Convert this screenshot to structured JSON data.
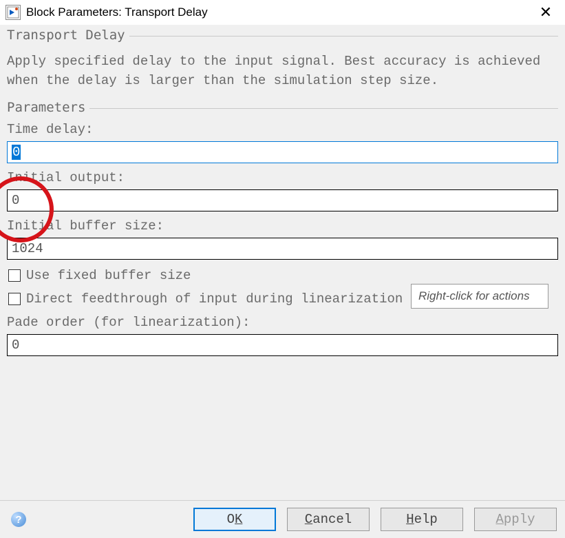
{
  "window": {
    "title": "Block Parameters: Transport Delay"
  },
  "group1": {
    "label": "Transport Delay",
    "description": "Apply specified delay to the input signal.  Best accuracy is achieved when the delay is larger than the simulation step size."
  },
  "group2": {
    "label": "Parameters"
  },
  "fields": {
    "time_delay_label": "Time delay:",
    "time_delay_value": "0",
    "initial_output_label": "Initial output:",
    "initial_output_value": "0",
    "initial_buffer_label": "Initial buffer size:",
    "initial_buffer_value": "1024",
    "use_fixed_label": "Use fixed buffer size",
    "direct_feed_label": "Direct feedthrough of input during linearization",
    "pade_label": "Pade order (for linearization):",
    "pade_value": "0"
  },
  "tooltip": {
    "text": "Right-click for actions"
  },
  "buttons": {
    "ok_pre": "O",
    "ok_u": "K",
    "cancel_u": "C",
    "cancel_post": "ancel",
    "help_u": "H",
    "help_post": "elp",
    "apply_u": "A",
    "apply_post": "pply"
  }
}
